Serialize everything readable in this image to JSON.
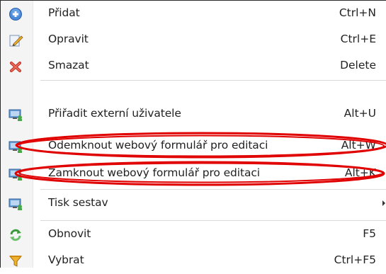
{
  "menu": {
    "items": [
      {
        "label": "Přidat",
        "shortcut": "Ctrl+N",
        "icon": "add-icon"
      },
      {
        "label": "Opravit",
        "shortcut": "Ctrl+E",
        "icon": "edit-icon"
      },
      {
        "label": "Smazat",
        "shortcut": "Delete",
        "icon": "delete-icon"
      },
      {
        "label": "Přiřadit externí uživatele",
        "shortcut": "Alt+U",
        "icon": "assign-users-icon"
      },
      {
        "label": "Odemknout webový formulář pro editaci",
        "shortcut": "Alt+W",
        "icon": "unlock-form-icon"
      },
      {
        "label": "Zamknout webový formulář pro editaci",
        "shortcut": "Alt+K",
        "icon": "lock-form-icon"
      },
      {
        "label": "Tisk sestav",
        "shortcut": "",
        "icon": "print-reports-icon",
        "submenu": true
      },
      {
        "label": "Obnovit",
        "shortcut": "F5",
        "icon": "refresh-icon"
      },
      {
        "label": "Vybrat",
        "shortcut": "Ctrl+F5",
        "icon": "filter-icon"
      }
    ]
  },
  "colors": {
    "annotation_red": "#e00000",
    "add_blue": "#3a7bd5",
    "delete_red": "#d9534f",
    "refresh_green": "#4aa84a",
    "filter_orange": "#e8a020"
  }
}
